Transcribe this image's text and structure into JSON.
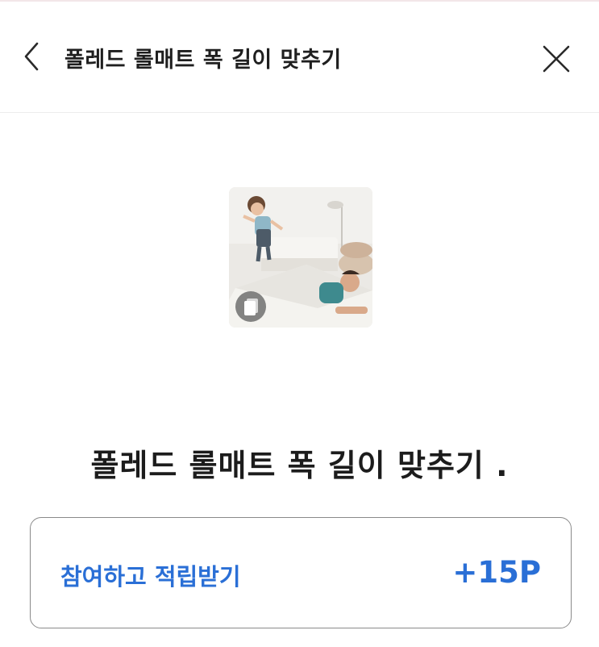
{
  "header": {
    "title": "폴레드 롤매트 폭 길이 맞추기",
    "back_icon": "chevron-left-icon",
    "close_icon": "close-icon"
  },
  "thumbnail": {
    "badge_icon": "multi-image-icon"
  },
  "main": {
    "title": "폴레드 롤매트 폭 길이 맞추기 ."
  },
  "reward": {
    "label": "참여하고 적립받기",
    "points": "+15P"
  },
  "colors": {
    "accent": "#2a6fd6",
    "text": "#1c1c1c",
    "border": "#8a8a8a"
  }
}
